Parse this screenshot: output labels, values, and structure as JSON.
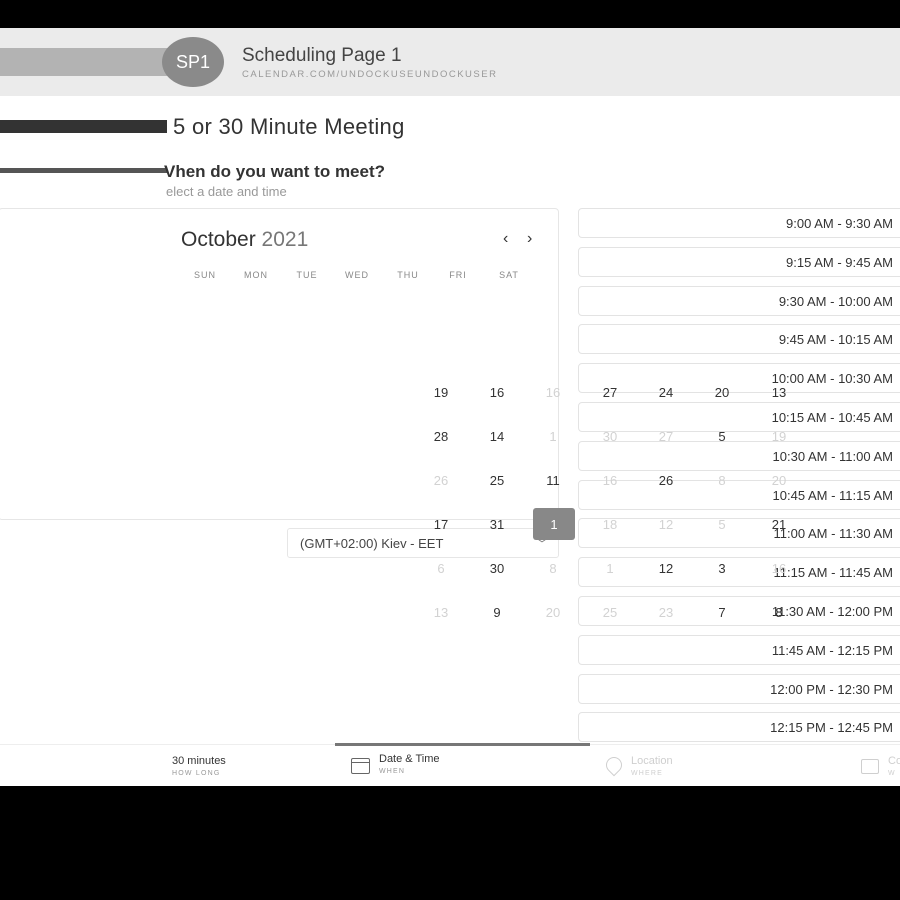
{
  "header": {
    "avatar_initials": "SP1",
    "page_name": "Scheduling Page 1",
    "url": "CALENDAR.COM/UNDOCKUSEUNDOCKUSER"
  },
  "event": {
    "title": "5 or 30 Minute Meeting",
    "question": "Vhen do you want to meet?",
    "subtext": "elect a date and time"
  },
  "calendar": {
    "month": "October",
    "year": "2021",
    "prev_icon": "‹",
    "next_icon": "›",
    "weekdays": [
      "SUN",
      "MON",
      "TUE",
      "WED",
      "THU",
      "FRI",
      "SAT"
    ],
    "days": [
      {
        "label": "19",
        "muted": false
      },
      {
        "label": "16",
        "muted": false
      },
      {
        "label": "16",
        "muted": true
      },
      {
        "label": "27",
        "muted": false
      },
      {
        "label": "24",
        "muted": false
      },
      {
        "label": "20",
        "muted": false
      },
      {
        "label": "13",
        "muted": false
      },
      {
        "label": "28",
        "muted": false
      },
      {
        "label": "14",
        "muted": false
      },
      {
        "label": "1",
        "muted": true
      },
      {
        "label": "30",
        "muted": true
      },
      {
        "label": "27",
        "muted": true
      },
      {
        "label": "5",
        "muted": false
      },
      {
        "label": "19",
        "muted": true
      },
      {
        "label": "26",
        "muted": true
      },
      {
        "label": "25",
        "muted": false
      },
      {
        "label": "11",
        "muted": false
      },
      {
        "label": "16",
        "muted": true
      },
      {
        "label": "26",
        "muted": false
      },
      {
        "label": "8",
        "muted": true
      },
      {
        "label": "20",
        "muted": true
      },
      {
        "label": "17",
        "muted": false
      },
      {
        "label": "31",
        "muted": false
      },
      {
        "label": "1",
        "muted": false,
        "selected": true
      },
      {
        "label": "18",
        "muted": true
      },
      {
        "label": "12",
        "muted": true
      },
      {
        "label": "5",
        "muted": true
      },
      {
        "label": "21",
        "muted": false
      },
      {
        "label": "6",
        "muted": true
      },
      {
        "label": "30",
        "muted": false
      },
      {
        "label": "8",
        "muted": true
      },
      {
        "label": "1",
        "muted": true
      },
      {
        "label": "12",
        "muted": false
      },
      {
        "label": "3",
        "muted": false
      },
      {
        "label": "16",
        "muted": true
      },
      {
        "label": "13",
        "muted": true
      },
      {
        "label": "9",
        "muted": false
      },
      {
        "label": "20",
        "muted": true
      },
      {
        "label": "25",
        "muted": true
      },
      {
        "label": "23",
        "muted": true
      },
      {
        "label": "7",
        "muted": false
      },
      {
        "label": "8",
        "muted": false
      }
    ]
  },
  "timezone": {
    "label": "(GMT+02:00) Kiev - EET",
    "chevron_icon": "﹀"
  },
  "time_slots": [
    "9:00 AM - 9:30 AM",
    "9:15 AM - 9:45 AM",
    "9:30 AM - 10:00 AM",
    "9:45 AM - 10:15 AM",
    "10:00 AM - 10:30 AM",
    "10:15 AM - 10:45 AM",
    "10:30 AM - 11:00 AM",
    "10:45 AM - 11:15 AM",
    "11:00 AM - 11:30 AM",
    "11:15 AM - 11:45 AM",
    "11:30 AM - 12:00 PM",
    "11:45 AM - 12:15 PM",
    "12:00 PM - 12:30 PM",
    "12:15 PM - 12:45 PM"
  ],
  "steps": {
    "how_long": {
      "value": "30 minutes",
      "label": "HOW LONG"
    },
    "when": {
      "value": "Date & Time",
      "label": "WHEN"
    },
    "where": {
      "value": "Location",
      "label": "WHERE"
    },
    "confirm": {
      "value": "Co",
      "label": "W"
    }
  }
}
